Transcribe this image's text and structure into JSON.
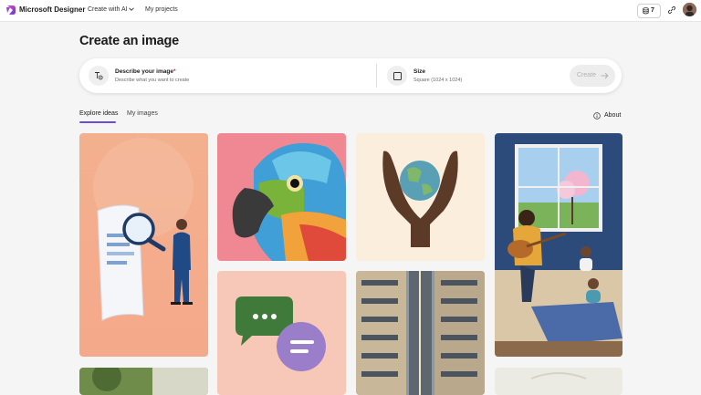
{
  "app": {
    "brand": "Microsoft Designer",
    "nav": {
      "create_with_ai": "Create with AI",
      "my_projects": "My projects"
    },
    "credits": "7",
    "icons": [
      "designer-logo-icon",
      "chevron-down-icon",
      "coin-stack-icon",
      "share-link-icon",
      "user-avatar"
    ]
  },
  "page": {
    "title": "Create an image",
    "prompt": {
      "describe_label": "Describe your image",
      "required_mark": "*",
      "describe_placeholder": "Describe what you want to create",
      "size_label": "Size",
      "size_value": "Square (1024 x 1024)",
      "create_label": "Create"
    },
    "tabs": [
      {
        "label": "Explore ideas",
        "selected": true
      },
      {
        "label": "My images",
        "selected": false
      }
    ],
    "about_label": "About"
  },
  "gallery": [
    {
      "subject": "person examining document with magnifying glass"
    },
    {
      "subject": "colorful parrot"
    },
    {
      "subject": "hands holding globe"
    },
    {
      "subject": "man playing guitar with child near window"
    },
    {
      "subject": "green nature"
    },
    {
      "subject": "chat bubbles"
    },
    {
      "subject": "aerial city street"
    },
    {
      "subject": "light pattern"
    }
  ],
  "colors": {
    "accent": "#6b4ed8",
    "background": "#f5f5f5",
    "required": "#c4314b"
  }
}
